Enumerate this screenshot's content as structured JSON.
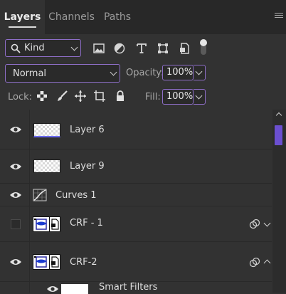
{
  "tabs": [
    "Layers",
    "Channels",
    "Paths"
  ],
  "filter": {
    "kind_label": "Kind"
  },
  "blend": {
    "mode": "Normal",
    "opacity_label": "Opacity:",
    "opacity_value": "100%"
  },
  "lock": {
    "label": "Lock:",
    "fill_label": "Fill:",
    "fill_value": "100%"
  },
  "layers": [
    {
      "name": "Layer 6"
    },
    {
      "name": "Layer 9"
    },
    {
      "name": "Curves 1"
    },
    {
      "name": "CRF - 1"
    },
    {
      "name": "CRF-2"
    },
    {
      "name": "Smart Filters"
    }
  ],
  "colors": {
    "accent": "#8e6ec8",
    "scroll_thumb": "#6b4fd0",
    "panel_bg": "#323232"
  }
}
